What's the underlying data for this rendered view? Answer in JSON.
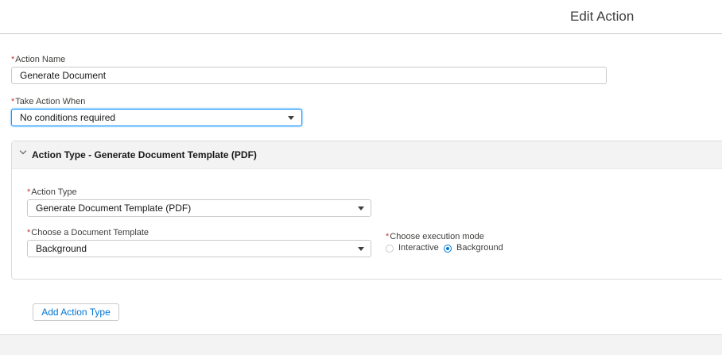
{
  "header": {
    "title": "Edit Action"
  },
  "form": {
    "required_marker": "*",
    "action_name": {
      "label": "Action Name",
      "value": "Generate Document"
    },
    "take_action_when": {
      "label": "Take Action When",
      "value": "No conditions required"
    }
  },
  "section": {
    "title": "Action Type - Generate Document Template (PDF)",
    "action_type": {
      "label": "Action Type",
      "value": "Generate Document Template (PDF)"
    },
    "document_template": {
      "label": "Choose a Document Template",
      "value": "Background"
    },
    "execution_mode": {
      "label": "Choose execution mode",
      "options": [
        "Interactive",
        "Background"
      ],
      "selected": "Background"
    }
  },
  "add_action_type_label": "Add Action Type",
  "colors": {
    "required": "#c23934",
    "accent": "#0176d3",
    "focus": "#1b96ff"
  },
  "icons": [
    "chevron-down-icon",
    "dropdown-caret-icon"
  ]
}
